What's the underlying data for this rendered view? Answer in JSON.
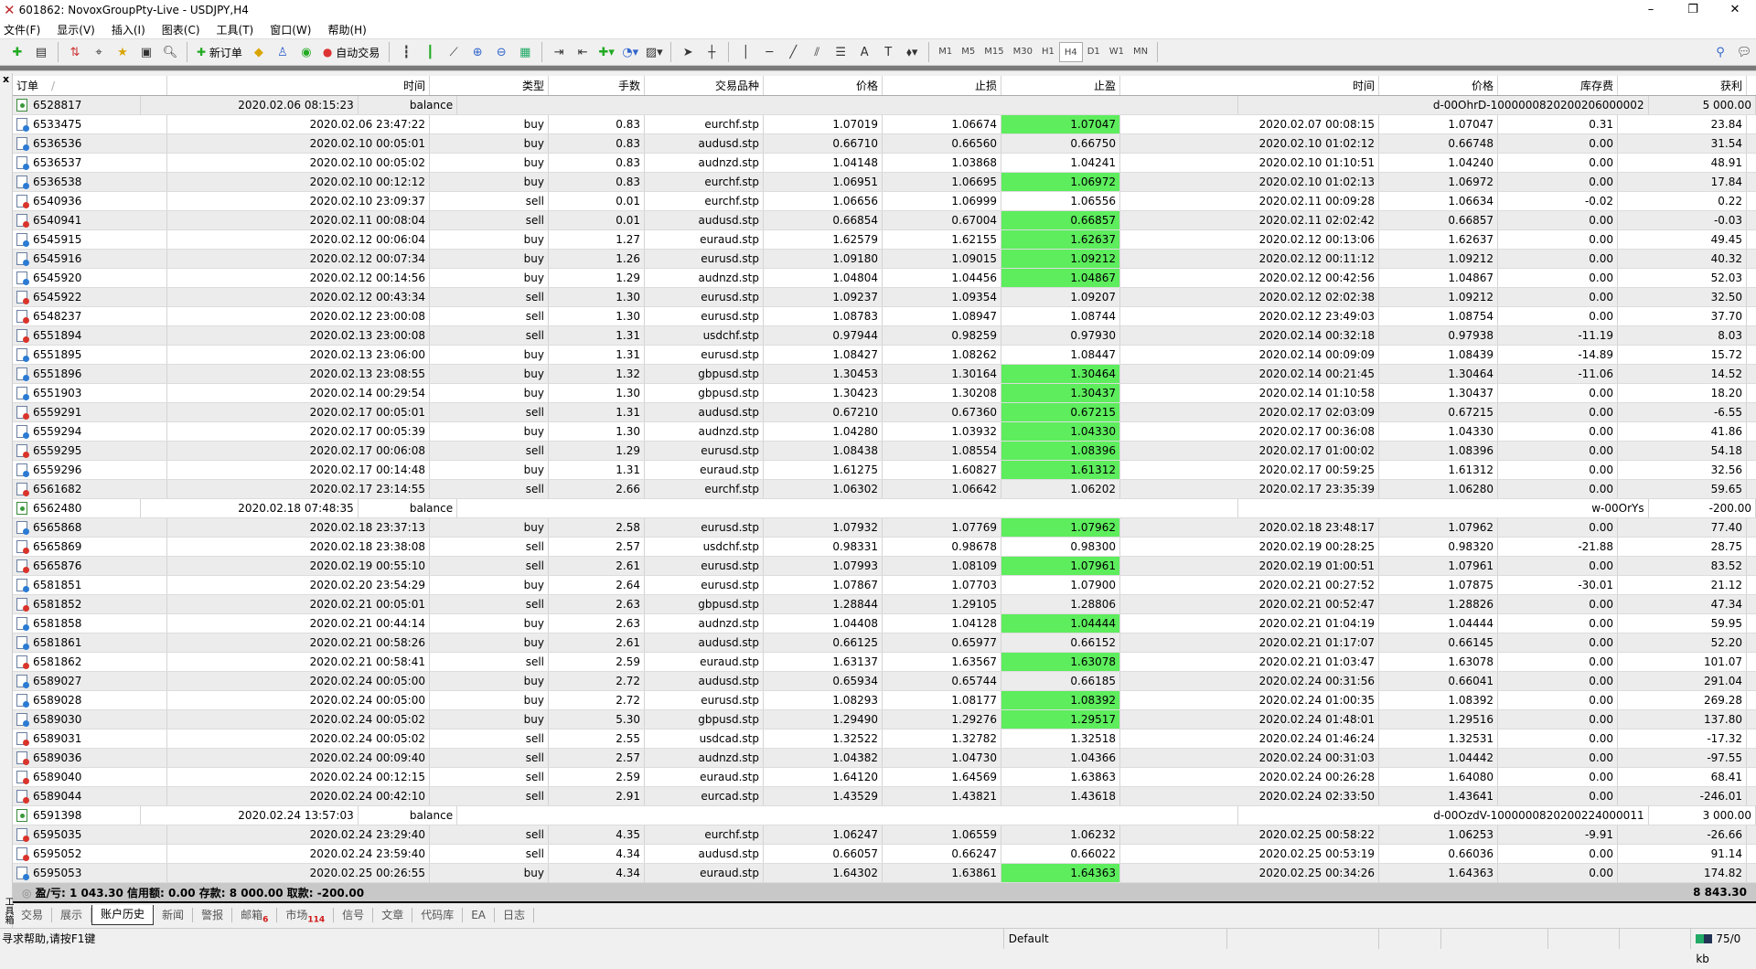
{
  "window": {
    "title": "601862: NovoxGroupPty-Live - USDJPY,H4",
    "min": "–",
    "max": "❐",
    "close": "✕"
  },
  "menu": [
    "文件(F)",
    "显示(V)",
    "插入(I)",
    "图表(C)",
    "工具(T)",
    "窗口(W)",
    "帮助(H)"
  ],
  "toolbar": {
    "new_order": "新订单",
    "auto_trade": "自动交易",
    "timeframes": [
      "M1",
      "M5",
      "M15",
      "M30",
      "H1",
      "H4",
      "D1",
      "W1",
      "MN"
    ],
    "active_timeframe": "H4"
  },
  "toolbox": {
    "close": "x",
    "label": "工具箱"
  },
  "table": {
    "headers": [
      "订单",
      "时间",
      "类型",
      "手数",
      "交易品种",
      "价格",
      "止损",
      "止盈",
      "时间",
      "价格",
      "库存费",
      "获利"
    ],
    "sort_indicator": "/",
    "rows": [
      {
        "order": "6528817",
        "time": "2020.02.06 08:15:23",
        "type": "balance",
        "comment": "d-00OhrD-1000000820200206000002",
        "profit": "5 000.00"
      },
      [
        "6533475",
        "2020.02.06 23:47:22",
        "buy",
        "0.83",
        "eurchf.stp",
        "1.07019",
        "1.06674",
        "1.07047",
        "2020.02.07 00:08:15",
        "1.07047",
        "0.31",
        "23.84",
        true
      ],
      [
        "6536536",
        "2020.02.10 00:05:01",
        "buy",
        "0.83",
        "audusd.stp",
        "0.66710",
        "0.66560",
        "0.66750",
        "2020.02.10 01:02:12",
        "0.66748",
        "0.00",
        "31.54",
        false
      ],
      [
        "6536537",
        "2020.02.10 00:05:02",
        "buy",
        "0.83",
        "audnzd.stp",
        "1.04148",
        "1.03868",
        "1.04241",
        "2020.02.10 01:10:51",
        "1.04240",
        "0.00",
        "48.91",
        false
      ],
      [
        "6536538",
        "2020.02.10 00:12:12",
        "buy",
        "0.83",
        "eurchf.stp",
        "1.06951",
        "1.06695",
        "1.06972",
        "2020.02.10 01:02:13",
        "1.06972",
        "0.00",
        "17.84",
        true
      ],
      [
        "6540936",
        "2020.02.10 23:09:37",
        "sell",
        "0.01",
        "eurchf.stp",
        "1.06656",
        "1.06999",
        "1.06556",
        "2020.02.11 00:09:28",
        "1.06634",
        "-0.02",
        "0.22",
        false
      ],
      [
        "6540941",
        "2020.02.11 00:08:04",
        "sell",
        "0.01",
        "audusd.stp",
        "0.66854",
        "0.67004",
        "0.66857",
        "2020.02.11 02:02:42",
        "0.66857",
        "0.00",
        "-0.03",
        true
      ],
      [
        "6545915",
        "2020.02.12 00:06:04",
        "buy",
        "1.27",
        "euraud.stp",
        "1.62579",
        "1.62155",
        "1.62637",
        "2020.02.12 00:13:06",
        "1.62637",
        "0.00",
        "49.45",
        true
      ],
      [
        "6545916",
        "2020.02.12 00:07:34",
        "buy",
        "1.26",
        "eurusd.stp",
        "1.09180",
        "1.09015",
        "1.09212",
        "2020.02.12 00:11:12",
        "1.09212",
        "0.00",
        "40.32",
        true
      ],
      [
        "6545920",
        "2020.02.12 00:14:56",
        "buy",
        "1.29",
        "audnzd.stp",
        "1.04804",
        "1.04456",
        "1.04867",
        "2020.02.12 00:42:56",
        "1.04867",
        "0.00",
        "52.03",
        true
      ],
      [
        "6545922",
        "2020.02.12 00:43:34",
        "sell",
        "1.30",
        "eurusd.stp",
        "1.09237",
        "1.09354",
        "1.09207",
        "2020.02.12 02:02:38",
        "1.09212",
        "0.00",
        "32.50",
        false
      ],
      [
        "6548237",
        "2020.02.12 23:00:08",
        "sell",
        "1.30",
        "eurusd.stp",
        "1.08783",
        "1.08947",
        "1.08744",
        "2020.02.12 23:49:03",
        "1.08754",
        "0.00",
        "37.70",
        false
      ],
      [
        "6551894",
        "2020.02.13 23:00:08",
        "sell",
        "1.31",
        "usdchf.stp",
        "0.97944",
        "0.98259",
        "0.97930",
        "2020.02.14 00:32:18",
        "0.97938",
        "-11.19",
        "8.03",
        false
      ],
      [
        "6551895",
        "2020.02.13 23:06:00",
        "buy",
        "1.31",
        "eurusd.stp",
        "1.08427",
        "1.08262",
        "1.08447",
        "2020.02.14 00:09:09",
        "1.08439",
        "-14.89",
        "15.72",
        false
      ],
      [
        "6551896",
        "2020.02.13 23:08:55",
        "buy",
        "1.32",
        "gbpusd.stp",
        "1.30453",
        "1.30164",
        "1.30464",
        "2020.02.14 00:21:45",
        "1.30464",
        "-11.06",
        "14.52",
        true
      ],
      [
        "6551903",
        "2020.02.14 00:29:54",
        "buy",
        "1.30",
        "gbpusd.stp",
        "1.30423",
        "1.30208",
        "1.30437",
        "2020.02.14 01:10:58",
        "1.30437",
        "0.00",
        "18.20",
        true
      ],
      [
        "6559291",
        "2020.02.17 00:05:01",
        "sell",
        "1.31",
        "audusd.stp",
        "0.67210",
        "0.67360",
        "0.67215",
        "2020.02.17 02:03:09",
        "0.67215",
        "0.00",
        "-6.55",
        true
      ],
      [
        "6559294",
        "2020.02.17 00:05:39",
        "buy",
        "1.30",
        "audnzd.stp",
        "1.04280",
        "1.03932",
        "1.04330",
        "2020.02.17 00:36:08",
        "1.04330",
        "0.00",
        "41.86",
        true
      ],
      [
        "6559295",
        "2020.02.17 00:06:08",
        "sell",
        "1.29",
        "eurusd.stp",
        "1.08438",
        "1.08554",
        "1.08396",
        "2020.02.17 01:00:02",
        "1.08396",
        "0.00",
        "54.18",
        true
      ],
      [
        "6559296",
        "2020.02.17 00:14:48",
        "buy",
        "1.31",
        "euraud.stp",
        "1.61275",
        "1.60827",
        "1.61312",
        "2020.02.17 00:59:25",
        "1.61312",
        "0.00",
        "32.56",
        true
      ],
      [
        "6561682",
        "2020.02.17 23:14:55",
        "sell",
        "2.66",
        "eurchf.stp",
        "1.06302",
        "1.06642",
        "1.06202",
        "2020.02.17 23:35:39",
        "1.06280",
        "0.00",
        "59.65",
        false
      ],
      {
        "order": "6562480",
        "time": "2020.02.18 07:48:35",
        "type": "balance",
        "comment": "w-00OrYs",
        "profit": "-200.00"
      },
      [
        "6565868",
        "2020.02.18 23:37:13",
        "buy",
        "2.58",
        "eurusd.stp",
        "1.07932",
        "1.07769",
        "1.07962",
        "2020.02.18 23:48:17",
        "1.07962",
        "0.00",
        "77.40",
        true
      ],
      [
        "6565869",
        "2020.02.18 23:38:08",
        "sell",
        "2.57",
        "usdchf.stp",
        "0.98331",
        "0.98678",
        "0.98300",
        "2020.02.19 00:28:25",
        "0.98320",
        "-21.88",
        "28.75",
        false
      ],
      [
        "6565876",
        "2020.02.19 00:55:10",
        "sell",
        "2.61",
        "eurusd.stp",
        "1.07993",
        "1.08109",
        "1.07961",
        "2020.02.19 01:00:51",
        "1.07961",
        "0.00",
        "83.52",
        true
      ],
      [
        "6581851",
        "2020.02.20 23:54:29",
        "buy",
        "2.64",
        "eurusd.stp",
        "1.07867",
        "1.07703",
        "1.07900",
        "2020.02.21 00:27:52",
        "1.07875",
        "-30.01",
        "21.12",
        false
      ],
      [
        "6581852",
        "2020.02.21 00:05:01",
        "sell",
        "2.63",
        "gbpusd.stp",
        "1.28844",
        "1.29105",
        "1.28806",
        "2020.02.21 00:52:47",
        "1.28826",
        "0.00",
        "47.34",
        false
      ],
      [
        "6581858",
        "2020.02.21 00:44:14",
        "buy",
        "2.63",
        "audnzd.stp",
        "1.04408",
        "1.04128",
        "1.04444",
        "2020.02.21 01:04:19",
        "1.04444",
        "0.00",
        "59.95",
        true
      ],
      [
        "6581861",
        "2020.02.21 00:58:26",
        "buy",
        "2.61",
        "audusd.stp",
        "0.66125",
        "0.65977",
        "0.66152",
        "2020.02.21 01:17:07",
        "0.66145",
        "0.00",
        "52.20",
        false
      ],
      [
        "6581862",
        "2020.02.21 00:58:41",
        "sell",
        "2.59",
        "euraud.stp",
        "1.63137",
        "1.63567",
        "1.63078",
        "2020.02.21 01:03:47",
        "1.63078",
        "0.00",
        "101.07",
        true
      ],
      [
        "6589027",
        "2020.02.24 00:05:00",
        "buy",
        "2.72",
        "audusd.stp",
        "0.65934",
        "0.65744",
        "0.66185",
        "2020.02.24 00:31:56",
        "0.66041",
        "0.00",
        "291.04",
        false
      ],
      [
        "6589028",
        "2020.02.24 00:05:00",
        "buy",
        "2.72",
        "eurusd.stp",
        "1.08293",
        "1.08177",
        "1.08392",
        "2020.02.24 01:00:35",
        "1.08392",
        "0.00",
        "269.28",
        true
      ],
      [
        "6589030",
        "2020.02.24 00:05:02",
        "buy",
        "5.30",
        "gbpusd.stp",
        "1.29490",
        "1.29276",
        "1.29517",
        "2020.02.24 01:48:01",
        "1.29516",
        "0.00",
        "137.80",
        true
      ],
      [
        "6589031",
        "2020.02.24 00:05:02",
        "sell",
        "2.55",
        "usdcad.stp",
        "1.32522",
        "1.32782",
        "1.32518",
        "2020.02.24 01:46:24",
        "1.32531",
        "0.00",
        "-17.32",
        false
      ],
      [
        "6589036",
        "2020.02.24 00:09:40",
        "sell",
        "2.57",
        "audnzd.stp",
        "1.04382",
        "1.04730",
        "1.04366",
        "2020.02.24 00:31:03",
        "1.04442",
        "0.00",
        "-97.55",
        false
      ],
      [
        "6589040",
        "2020.02.24 00:12:15",
        "sell",
        "2.59",
        "euraud.stp",
        "1.64120",
        "1.64569",
        "1.63863",
        "2020.02.24 00:26:28",
        "1.64080",
        "0.00",
        "68.41",
        false
      ],
      [
        "6589044",
        "2020.02.24 00:42:10",
        "sell",
        "2.91",
        "eurcad.stp",
        "1.43529",
        "1.43821",
        "1.43618",
        "2020.02.24 02:33:50",
        "1.43641",
        "0.00",
        "-246.01",
        false
      ],
      {
        "order": "6591398",
        "time": "2020.02.24 13:57:03",
        "type": "balance",
        "comment": "d-00OzdV-1000000820200224000011",
        "profit": "3 000.00"
      },
      [
        "6595035",
        "2020.02.24 23:29:40",
        "sell",
        "4.35",
        "eurchf.stp",
        "1.06247",
        "1.06559",
        "1.06232",
        "2020.02.25 00:58:22",
        "1.06253",
        "-9.91",
        "-26.66",
        false
      ],
      [
        "6595052",
        "2020.02.24 23:59:40",
        "sell",
        "4.34",
        "audusd.stp",
        "0.66057",
        "0.66247",
        "0.66022",
        "2020.02.25 00:53:19",
        "0.66036",
        "0.00",
        "91.14",
        false
      ],
      [
        "6595053",
        "2020.02.25 00:26:55",
        "buy",
        "4.34",
        "euraud.stp",
        "1.64302",
        "1.63861",
        "1.64363",
        "2020.02.25 00:34:26",
        "1.64363",
        "0.00",
        "174.82",
        true
      ]
    ]
  },
  "summary": {
    "text": "盈/亏: 1 043.30  信用额: 0.00  存款: 8 000.00  取款: -200.00",
    "total": "8 843.30"
  },
  "tabs": [
    {
      "label": "交易"
    },
    {
      "label": "展示"
    },
    {
      "label": "账户历史",
      "active": true
    },
    {
      "label": "新闻"
    },
    {
      "label": "警报"
    },
    {
      "label": "邮箱",
      "badge": "6"
    },
    {
      "label": "市场",
      "badge": "114"
    },
    {
      "label": "信号"
    },
    {
      "label": "文章"
    },
    {
      "label": "代码库"
    },
    {
      "label": "EA"
    },
    {
      "label": "日志"
    }
  ],
  "status": {
    "help": "寻求帮助,请按F1键",
    "profile": "Default",
    "traffic": "75/0 kb"
  },
  "colors": {
    "tp_hit": "#5ded5d",
    "summary_bg": "#c8c8c8"
  }
}
